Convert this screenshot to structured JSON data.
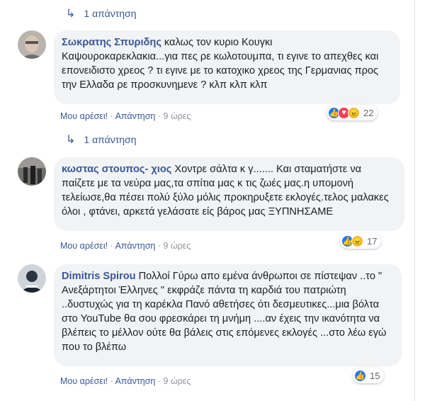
{
  "colors": {
    "link": "#385898",
    "bubble": "#f2f3f5",
    "meta": "#90949c",
    "like": "#2078f4",
    "love": "#f33e58",
    "angry": "#e9710f"
  },
  "replies_link_1": "1 απάντηση",
  "replies_link_2": "1 απάντηση",
  "comments": [
    {
      "author": "Σωκρατης Σπυριδης",
      "text": "καλως τον κυριο Κουγκι Καψουροκαρεκλακια...για πες ρε κωλοτουμπα, τι εγινε το απεχθες και επονειδιστο χρεος ? τι εγινε με το κατοχικο χρεος της Γερμανιας προς την Ελλαδα ρε προσκυνημενε ? κλπ κλπ κλπ",
      "like": "Μου αρέσει!",
      "reply": "Απάντηση",
      "time": "9 ώρες",
      "reactions": [
        "like-icon",
        "love-icon",
        "angry-icon"
      ],
      "count": "22"
    },
    {
      "author": "κωστας στουπος- χιος",
      "text": "Χοντρε σάλτα κ γ....... Και σταματήστε να παίζετε με τα νεύρα μας,τα σπίτια μας κ τις ζωές μας.η υπομονή τελείωσε,θα πέσει πολύ ξύλο μόλις προκηρυξετε εκλογές.τελος μαλακες όλοι , φτάνει, αρκετά γελάσατε είς βάρος μας ΞΥΠΝΗΣΑΜΕ",
      "like": "Μου αρέσει!",
      "reply": "Απάντηση",
      "time": "9 ώρες",
      "reactions": [
        "like-icon",
        "angry-icon"
      ],
      "count": "17"
    },
    {
      "author": "Dimitris Spirou",
      "text": "Πολλοί Γύρω απο εμένα άνθρωποι σε πίστεψαν ..το \" Ανεξάρτητοι Έλληνες \" εκφράζε πάντα τη καρδιά του πατριώτη ..δυστυχώς για τη καρέκλα Πανό αθετήσες ότι δεσμευτικες...μια βόλτα στο YouTube θα σου φρεσκάρει τη μνήμη ....αν έχεις την ικανότητα να βλέπεις το μέλλον ούτε θα βάλεις στις επόμενες εκλογές ...στο λέω εγώ που το βλέπω",
      "like": "Μου αρέσει!",
      "reply": "Απάντηση",
      "time": "9 ώρες",
      "reactions": [
        "like-icon"
      ],
      "count": "15"
    }
  ]
}
